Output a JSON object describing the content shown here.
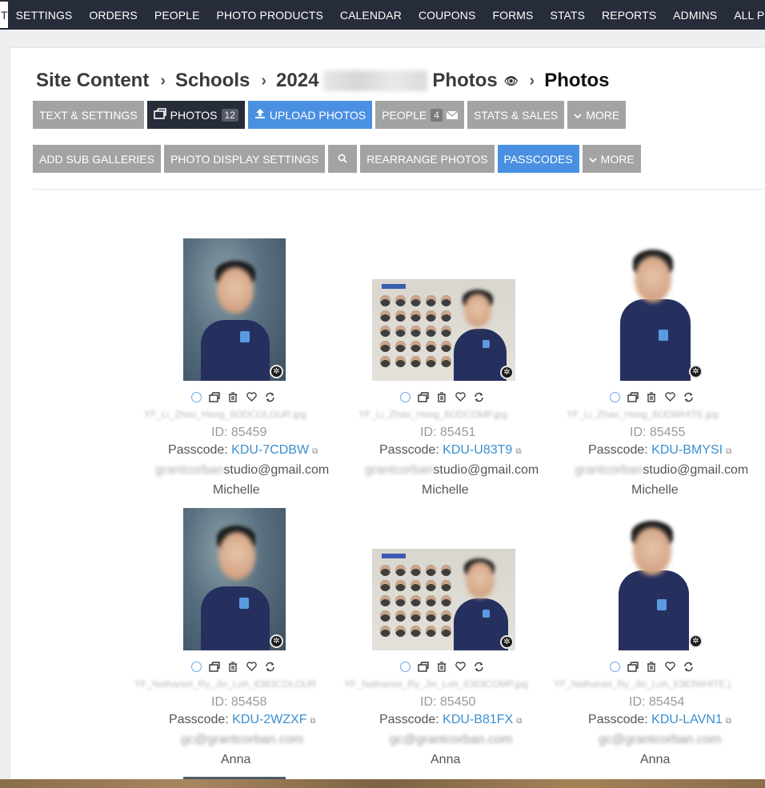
{
  "nav": {
    "first_label": "T",
    "items": [
      "SETTINGS",
      "ORDERS",
      "PEOPLE",
      "PHOTO PRODUCTS",
      "CALENDAR",
      "COUPONS",
      "FORMS",
      "STATS",
      "REPORTS",
      "ADMINS",
      "ALL PHOTOS"
    ]
  },
  "breadcrumb": {
    "site_content": "Site Content",
    "schools": "Schools",
    "year": "2024",
    "gallery": "Photos",
    "current": "Photos"
  },
  "toolbar1": {
    "text_settings": "TEXT & SETTINGS",
    "photos": "PHOTOS",
    "photos_count": "12",
    "upload": "UPLOAD PHOTOS",
    "people": "PEOPLE",
    "people_count": "4",
    "stats": "STATS & SALES",
    "more": "MORE"
  },
  "toolbar2": {
    "add_sub": "ADD SUB GALLERIES",
    "display": "PHOTO DISPLAY SETTINGS",
    "rearrange": "REARRANGE PHOTOS",
    "passcodes": "PASSCODES",
    "more": "MORE"
  },
  "photos": [
    {
      "id": "ID: 85459",
      "passcode_label": "Passcode:",
      "passcode": "KDU-7CDBW",
      "email_suffix": "studio@gmail.com",
      "name": "Michelle",
      "filename": "YF_Li_Zhao_Heng_6ODCOLOUR.jpg"
    },
    {
      "id": "ID: 85451",
      "passcode_label": "Passcode:",
      "passcode": "KDU-U83T9",
      "email_suffix": "studio@gmail.com",
      "name": "Michelle",
      "filename": "YF_Li_Zhao_Heng_6ODCOMP.jpg"
    },
    {
      "id": "ID: 85455",
      "passcode_label": "Passcode:",
      "passcode": "KDU-BMYSI",
      "email_suffix": "studio@gmail.com",
      "name": "Michelle",
      "filename": "YF_Li_Zhao_Heng_6ODWHITE.jpg"
    },
    {
      "id": "ID: 85458",
      "passcode_label": "Passcode:",
      "passcode": "KDU-2WZXF",
      "email_suffix": "",
      "name": "Anna",
      "filename": "YF_Nathaniel_Ry_Jin_Loh_6363COLOUR"
    },
    {
      "id": "ID: 85450",
      "passcode_label": "Passcode:",
      "passcode": "KDU-B81FX",
      "email_suffix": "",
      "name": "Anna",
      "filename": "YF_Nathaniel_Ry_Jin_Loh_6363COMP.jpg"
    },
    {
      "id": "ID: 85454",
      "passcode_label": "Passcode:",
      "passcode": "KDU-LAVN1",
      "email_suffix": "",
      "name": "Anna",
      "filename": "YF_Nathaniel_Ry_Jin_Loh_6363WHITE.j"
    }
  ],
  "colors": {
    "nav_bg": "#272c3a",
    "accent_blue": "#4a90e2",
    "button_gray": "#a3a3a3",
    "link_blue": "#3b8fd0"
  }
}
